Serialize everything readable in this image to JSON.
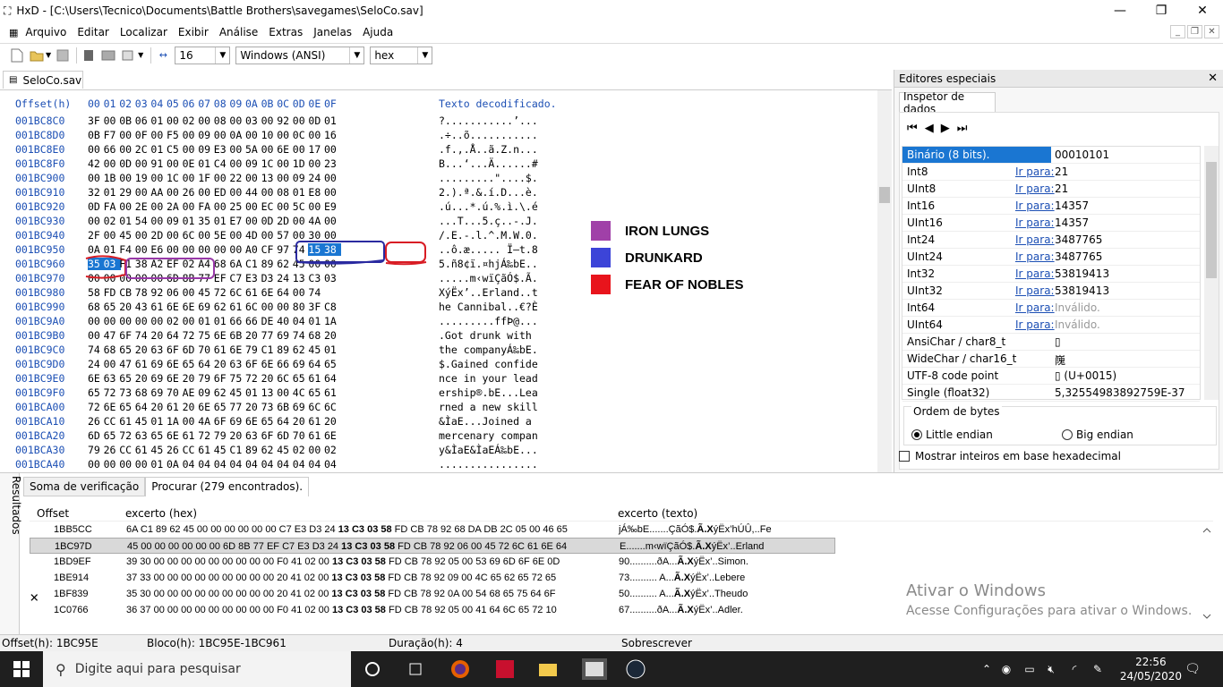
{
  "window": {
    "title": "HxD - [C:\\Users\\Tecnico\\Documents\\Battle Brothers\\savegames\\SeloCo.sav]"
  },
  "menu": [
    "Arquivo",
    "Editar",
    "Localizar",
    "Exibir",
    "Análise",
    "Extras",
    "Janelas",
    "Ajuda"
  ],
  "toolbar": {
    "bytes_per_row": "16",
    "charset": "Windows (ANSI)",
    "offset_base": "hex"
  },
  "doc_tab": "SeloCo.sav",
  "hex": {
    "header_offset": "Offset(h)",
    "header_cols": [
      "00",
      "01",
      "02",
      "03",
      "04",
      "05",
      "06",
      "07",
      "08",
      "09",
      "0A",
      "0B",
      "0C",
      "0D",
      "0E",
      "0F"
    ],
    "header_text": "Texto decodificado.",
    "rows": [
      {
        "o": "001BC8C0",
        "b": [
          "3F",
          "00",
          "0B",
          "06",
          "01",
          "00",
          "02",
          "00",
          "08",
          "00",
          "03",
          "00",
          "92",
          "00",
          "0D",
          "01"
        ],
        "t": "?...........’..."
      },
      {
        "o": "001BC8D0",
        "b": [
          "0B",
          "F7",
          "00",
          "0F",
          "00",
          "F5",
          "00",
          "09",
          "00",
          "0A",
          "00",
          "10",
          "00",
          "0C",
          "00",
          "16"
        ],
        "t": ".÷..õ..........."
      },
      {
        "o": "001BC8E0",
        "b": [
          "00",
          "66",
          "00",
          "2C",
          "01",
          "C5",
          "00",
          "09",
          "E3",
          "00",
          "5A",
          "00",
          "6E",
          "00",
          "17",
          "00"
        ],
        "t": ".f.,.Å..ã.Z.n..."
      },
      {
        "o": "001BC8F0",
        "b": [
          "42",
          "00",
          "0D",
          "00",
          "91",
          "00",
          "0E",
          "01",
          "C4",
          "00",
          "09",
          "1C",
          "00",
          "1D",
          "00",
          "23"
        ],
        "t": "B...‘...Ä......#"
      },
      {
        "o": "001BC900",
        "b": [
          "00",
          "1B",
          "00",
          "19",
          "00",
          "1C",
          "00",
          "1F",
          "00",
          "22",
          "00",
          "13",
          "00",
          "09",
          "24",
          "00"
        ],
        "t": ".........\"....$."
      },
      {
        "o": "001BC910",
        "b": [
          "32",
          "01",
          "29",
          "00",
          "AA",
          "00",
          "26",
          "00",
          "ED",
          "00",
          "44",
          "00",
          "08",
          "01",
          "E8",
          "00"
        ],
        "t": "2.).ª.&.í.D...è."
      },
      {
        "o": "001BC920",
        "b": [
          "0D",
          "FA",
          "00",
          "2E",
          "00",
          "2A",
          "00",
          "FA",
          "00",
          "25",
          "00",
          "EC",
          "00",
          "5C",
          "00",
          "E9"
        ],
        "t": ".ú...*.ú.%.ì.\\.é"
      },
      {
        "o": "001BC930",
        "b": [
          "00",
          "02",
          "01",
          "54",
          "00",
          "09",
          "01",
          "35",
          "01",
          "E7",
          "00",
          "0D",
          "2D",
          "00",
          "4A",
          "00"
        ],
        "t": "...T...5.ç..-.J."
      },
      {
        "o": "001BC940",
        "b": [
          "2F",
          "00",
          "45",
          "00",
          "2D",
          "00",
          "6C",
          "00",
          "5E",
          "00",
          "4D",
          "00",
          "57",
          "00",
          "30",
          "00"
        ],
        "t": "/.E.-.l.^.M.W.0."
      },
      {
        "o": "001BC950",
        "b": [
          "0A",
          "01",
          "F4",
          "00",
          "E6",
          "00",
          "00",
          "00",
          "00",
          "00",
          "A0",
          "CF",
          "97",
          "74",
          "15",
          "38"
        ],
        "t": "..ô.æ..... Ï—t.8"
      },
      {
        "o": "001BC960",
        "b": [
          "35",
          "03",
          "F1",
          "38",
          "A2",
          "EF",
          "02",
          "A4",
          "68",
          "6A",
          "C1",
          "89",
          "62",
          "45",
          "00",
          "00"
        ],
        "t": "5.ñ8¢ï.¤hjÁ‰bE.."
      },
      {
        "o": "001BC970",
        "b": [
          "00",
          "00",
          "00",
          "00",
          "00",
          "6D",
          "8B",
          "77",
          "EF",
          "C7",
          "E3",
          "D3",
          "24",
          "13",
          "C3",
          "03"
        ],
        "t": ".....m‹wïÇãÓ$.Ã."
      },
      {
        "o": "001BC980",
        "b": [
          "58",
          "FD",
          "CB",
          "78",
          "92",
          "06",
          "00",
          "45",
          "72",
          "6C",
          "61",
          "6E",
          "64",
          "00",
          "74"
        ],
        "t": "XýËx’..Erland..t"
      },
      {
        "o": "001BC990",
        "b": [
          "68",
          "65",
          "20",
          "43",
          "61",
          "6E",
          "6E",
          "69",
          "62",
          "61",
          "6C",
          "00",
          "00",
          "80",
          "3F",
          "C8"
        ],
        "t": "he Cannibal..€?È"
      },
      {
        "o": "001BC9A0",
        "b": [
          "00",
          "00",
          "00",
          "00",
          "00",
          "02",
          "00",
          "01",
          "01",
          "66",
          "66",
          "DE",
          "40",
          "04",
          "01",
          "1A"
        ],
        "t": ".........ffÞ@..."
      },
      {
        "o": "001BC9B0",
        "b": [
          "00",
          "47",
          "6F",
          "74",
          "20",
          "64",
          "72",
          "75",
          "6E",
          "6B",
          "20",
          "77",
          "69",
          "74",
          "68",
          "20"
        ],
        "t": ".Got drunk with "
      },
      {
        "o": "001BC9C0",
        "b": [
          "74",
          "68",
          "65",
          "20",
          "63",
          "6F",
          "6D",
          "70",
          "61",
          "6E",
          "79",
          "C1",
          "89",
          "62",
          "45",
          "01"
        ],
        "t": "the companyÁ‰bE."
      },
      {
        "o": "001BC9D0",
        "b": [
          "24",
          "00",
          "47",
          "61",
          "69",
          "6E",
          "65",
          "64",
          "20",
          "63",
          "6F",
          "6E",
          "66",
          "69",
          "64",
          "65"
        ],
        "t": "$.Gained confide"
      },
      {
        "o": "001BC9E0",
        "b": [
          "6E",
          "63",
          "65",
          "20",
          "69",
          "6E",
          "20",
          "79",
          "6F",
          "75",
          "72",
          "20",
          "6C",
          "65",
          "61",
          "64"
        ],
        "t": "nce in your lead"
      },
      {
        "o": "001BC9F0",
        "b": [
          "65",
          "72",
          "73",
          "68",
          "69",
          "70",
          "AE",
          "09",
          "62",
          "45",
          "01",
          "13",
          "00",
          "4C",
          "65",
          "61"
        ],
        "t": "ership®.bE...Lea"
      },
      {
        "o": "001BCA00",
        "b": [
          "72",
          "6E",
          "65",
          "64",
          "20",
          "61",
          "20",
          "6E",
          "65",
          "77",
          "20",
          "73",
          "6B",
          "69",
          "6C",
          "6C"
        ],
        "t": "rned a new skill"
      },
      {
        "o": "001BCA10",
        "b": [
          "26",
          "CC",
          "61",
          "45",
          "01",
          "1A",
          "00",
          "4A",
          "6F",
          "69",
          "6E",
          "65",
          "64",
          "20",
          "61",
          "20"
        ],
        "t": "&ÌaE...Joined a "
      },
      {
        "o": "001BCA20",
        "b": [
          "6D",
          "65",
          "72",
          "63",
          "65",
          "6E",
          "61",
          "72",
          "79",
          "20",
          "63",
          "6F",
          "6D",
          "70",
          "61",
          "6E"
        ],
        "t": "mercenary compan"
      },
      {
        "o": "001BCA30",
        "b": [
          "79",
          "26",
          "CC",
          "61",
          "45",
          "26",
          "CC",
          "61",
          "45",
          "C1",
          "89",
          "62",
          "45",
          "02",
          "00",
          "02"
        ],
        "t": "y&ÌaE&ÌaEÁ‰bE..."
      },
      {
        "o": "001BCA40",
        "b": [
          "00",
          "00",
          "00",
          "00",
          "01",
          "0A",
          "04",
          "04",
          "04",
          "04",
          "04",
          "04",
          "04",
          "04",
          "04",
          "04"
        ],
        "t": "................"
      }
    ]
  },
  "legend": [
    {
      "label": "IRON LUNGS",
      "color": "#a040a8"
    },
    {
      "label": "DRUNKARD",
      "color": "#3c44d8"
    },
    {
      "label": "FEAR OF NOBLES",
      "color": "#e8141c"
    }
  ],
  "annot_colors": {
    "red": "#d81c24",
    "blue": "#2a2aa0",
    "purple": "#9838a8"
  },
  "inspector": {
    "panel_title": "Editores especiais",
    "tab": "Inspetor de dados",
    "goto": "Ir para:",
    "rows": [
      {
        "name": "Binário (8 bits).",
        "goto": false,
        "value": "00010101",
        "gray": false
      },
      {
        "name": "Int8",
        "goto": true,
        "value": "21",
        "gray": false
      },
      {
        "name": "UInt8",
        "goto": true,
        "value": "21",
        "gray": false
      },
      {
        "name": "Int16",
        "goto": true,
        "value": "14357",
        "gray": false
      },
      {
        "name": "UInt16",
        "goto": true,
        "value": "14357",
        "gray": false
      },
      {
        "name": "Int24",
        "goto": true,
        "value": "3487765",
        "gray": false
      },
      {
        "name": "UInt24",
        "goto": true,
        "value": "3487765",
        "gray": false
      },
      {
        "name": "Int32",
        "goto": true,
        "value": "53819413",
        "gray": false
      },
      {
        "name": "UInt32",
        "goto": true,
        "value": "53819413",
        "gray": false
      },
      {
        "name": "Int64",
        "goto": true,
        "value": "Inválido.",
        "gray": true
      },
      {
        "name": "UInt64",
        "goto": true,
        "value": "Inválido.",
        "gray": true
      },
      {
        "name": "AnsiChar / char8_t",
        "goto": false,
        "value": "▯",
        "gray": false
      },
      {
        "name": "WideChar / char16_t",
        "goto": false,
        "value": "㠕",
        "gray": false
      },
      {
        "name": "UTF-8 code point",
        "goto": false,
        "value": "▯ (U+0015)",
        "gray": false
      },
      {
        "name": "Single (float32)",
        "goto": false,
        "value": "5,32554983892759E-37",
        "gray": false
      }
    ],
    "byte_order_label": "Ordem de bytes",
    "little": "Little endian",
    "big": "Big endian",
    "hex_checkbox": "Mostrar inteiros em base hexadecimal"
  },
  "results": {
    "side_label": "Resultados",
    "tabs": [
      "Soma de verificação",
      "Procurar (279 encontrados)."
    ],
    "cols": [
      "Offset",
      "excerto (hex)",
      "excerto (texto)"
    ],
    "rows": [
      {
        "off": "1BB5CC",
        "hexA": "6A C1 89 62 45 00 00 00 00 00 00 C7 E3 D3 24 ",
        "hexB": "13 C3 03 58",
        "hexC": " FD CB 78 92 68 DA DB 2C 05 00 46 65",
        "txtA": "jÁ‰bE.......ÇãÓ$.",
        "txtB": "Ã.X",
        "txtC": "ýËx’hÚÛ,..Fe"
      },
      {
        "off": "1BC97D",
        "hexA": "45 00 00 00 00 00 00 6D 8B 77 EF C7 E3 D3 24 ",
        "hexB": "13 C3 03 58",
        "hexC": " FD CB 78 92 06 00 45 72 6C 61 6E 64",
        "txtA": "E.......m‹wïÇãÓ$.",
        "txtB": "Ã.X",
        "txtC": "ýËx’..Erland"
      },
      {
        "off": "1BD9EF",
        "hexA": "39 30 00 00 00 00 00 00 00 00 00 F0 41 02 00 ",
        "hexB": "13 C3 03 58",
        "hexC": " FD CB 78 92 05 00 53 69 6D 6F 6E 0D",
        "txtA": "90..........ðA...",
        "txtB": "Ã.X",
        "txtC": "ýËx’..Simon."
      },
      {
        "off": "1BE914",
        "hexA": "37 33 00 00 00 00 00 00 00 00 00 20 41 02 00 ",
        "hexB": "13 C3 03 58",
        "hexC": " FD CB 78 92 09 00 4C 65 62 65 72 65",
        "txtA": "73.......... A...",
        "txtB": "Ã.X",
        "txtC": "ýËx’..Lebere"
      },
      {
        "off": "1BF839",
        "hexA": "35 30 00 00 00 00 00 00 00 00 00 20 41 02 00 ",
        "hexB": "13 C3 03 58",
        "hexC": " FD CB 78 92 0A 00 54 68 65 75 64 6F",
        "txtA": "50.......... A...",
        "txtB": "Ã.X",
        "txtC": "ýËx’..Theudo"
      },
      {
        "off": "1C0766",
        "hexA": "36 37 00 00 00 00 00 00 00 00 00 F0 41 02 00 ",
        "hexB": "13 C3 03 58",
        "hexC": " FD CB 78 92 05 00 41 64 6C 65 72 10",
        "txtA": "67..........ðA...",
        "txtB": "Ã.X",
        "txtC": "ýËx’..Adler."
      }
    ]
  },
  "watermark": {
    "line1": "Ativar o Windows",
    "line2": "Acesse Configurações para ativar o Windows."
  },
  "status": {
    "offset": "Offset(h): 1BC95E",
    "block": "Bloco(h): 1BC95E-1BC961",
    "duration": "Duração(h): 4",
    "mode": "Sobrescrever"
  },
  "taskbar": {
    "search": "Digite aqui para pesquisar",
    "time": "22:56",
    "date": "24/05/2020"
  }
}
